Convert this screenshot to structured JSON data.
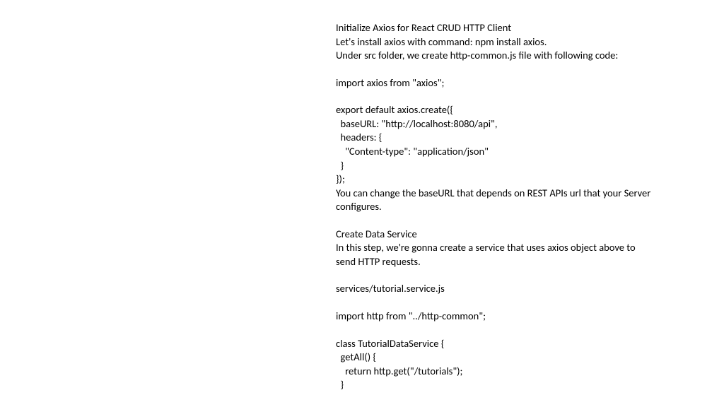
{
  "lines": [
    "Initialize Axios for React CRUD HTTP Client",
    "Let's install axios with command: npm install axios.",
    "Under src folder, we create http-common.js file with following code:",
    "",
    "import axios from \"axios\";",
    "",
    "export default axios.create({",
    "  baseURL: \"http://localhost:8080/api\",",
    "  headers: {",
    "    \"Content-type\": \"application/json\"",
    "  }",
    "});",
    "You can change the baseURL that depends on REST APIs url that your Server",
    "configures.",
    "",
    "Create Data Service",
    "In this step, we're gonna create a service that uses axios object above to",
    "send HTTP requests.",
    "",
    "services/tutorial.service.js",
    "",
    "import http from \"../http-common\";",
    "",
    "class TutorialDataService {",
    "  getAll() {",
    "    return http.get(\"/tutorials\");",
    "  }"
  ]
}
